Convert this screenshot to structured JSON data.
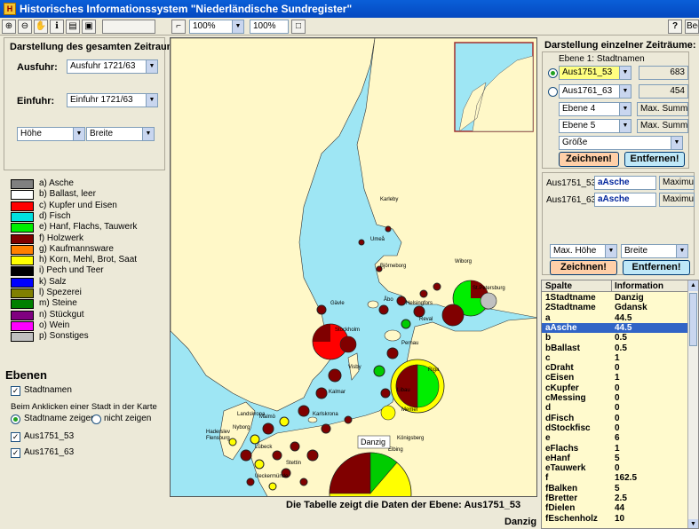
{
  "title": "Historisches Informationssystem \"Niederländische Sundregister\"",
  "toolbar": {
    "zoom1": "100%",
    "zoom2": "100%",
    "help": "?",
    "exit": "Beend"
  },
  "left": {
    "section_title": "Darstellung des gesamten Zeitraums",
    "ausfuhr_label": "Ausfuhr:",
    "ausfuhr_value": "Ausfuhr 1721/63",
    "einfuhr_label": "Einfuhr:",
    "einfuhr_value": "Einfuhr 1721/63",
    "hoehe_value": "Höhe",
    "breite_value": "Breite",
    "legend": [
      {
        "label": "a) Asche",
        "color": "#808080"
      },
      {
        "label": "b) Ballast, leer",
        "color": "#ffffff"
      },
      {
        "label": "c) Kupfer und Eisen",
        "color": "#ff0000"
      },
      {
        "label": "d) Fisch",
        "color": "#00e0e0"
      },
      {
        "label": "e) Hanf, Flachs, Tauwerk",
        "color": "#00ee00"
      },
      {
        "label": "f) Holzwerk",
        "color": "#800000"
      },
      {
        "label": "g) Kaufmannsware",
        "color": "#ff8000"
      },
      {
        "label": "h) Korn, Mehl, Brot, Saat",
        "color": "#ffff00"
      },
      {
        "label": "i) Pech und Teer",
        "color": "#000000"
      },
      {
        "label": "k) Salz",
        "color": "#0000ff"
      },
      {
        "label": "l) Spezerei",
        "color": "#808000"
      },
      {
        "label": "m) Steine",
        "color": "#008000"
      },
      {
        "label": "n) Stückgut",
        "color": "#800080"
      },
      {
        "label": "o) Wein",
        "color": "#ff00ff"
      },
      {
        "label": "p) Sonstiges",
        "color": "#c0c0c0"
      }
    ],
    "ebenen_title": "Ebenen",
    "stadtnamen": "Stadtnamen",
    "click_hint": "Beim Anklicken einer Stadt in der Karte",
    "radio_show": "Stadtname zeigen",
    "radio_hide": "nicht zeigen",
    "layer1": "Aus1751_53",
    "layer2": "Aus1761_63"
  },
  "right": {
    "section_title": "Darstellung einzelner Zeiträume:",
    "group_label": "Ebene 1: Stadtnamen",
    "sel1": "Aus1751_53",
    "val1": "683",
    "sel2": "Aus1761_63",
    "val2": "454",
    "ebene4": "Ebene 4",
    "ebene5": "Ebene 5",
    "max_summe": "Max. Summe",
    "groesse": "Größe",
    "btn_draw": "Zeichnen!",
    "btn_remove": "Entfernen!",
    "row1_label": "Aus1751_53:",
    "row1_field": "aAsche",
    "row1_max": "Maximum",
    "row2_label": "Aus1761_63:",
    "row2_field": "aAsche",
    "row2_max": "Maximum",
    "max_hoehe": "Max. Höhe",
    "breite": "Breite",
    "btn_draw2": "Zeichnen!",
    "btn_remove2": "Entfernen!"
  },
  "grid": {
    "col1": "Spalte",
    "col2": "Information",
    "rows": [
      [
        "1Stadtname",
        "Danzig"
      ],
      [
        "2Stadtname",
        "Gdansk"
      ],
      [
        "a",
        "44.5"
      ],
      [
        "aAsche",
        "44.5"
      ],
      [
        "b",
        "0.5"
      ],
      [
        "bBallast",
        "0.5"
      ],
      [
        "c",
        "1"
      ],
      [
        "cDraht",
        "0"
      ],
      [
        "cEisen",
        "1"
      ],
      [
        "cKupfer",
        "0"
      ],
      [
        "cMessing",
        "0"
      ],
      [
        "d",
        "0"
      ],
      [
        "dFisch",
        "0"
      ],
      [
        "dStockfisc",
        "0"
      ],
      [
        "e",
        "6"
      ],
      [
        "eFlachs",
        "1"
      ],
      [
        "eHanf",
        "5"
      ],
      [
        "eTauwerk",
        "0"
      ],
      [
        "f",
        "162.5"
      ],
      [
        "fBalken",
        "5"
      ],
      [
        "fBretter",
        "2.5"
      ],
      [
        "fDielen",
        "44"
      ],
      [
        "fEschenholz",
        "10"
      ]
    ]
  },
  "map": {
    "cities": [
      "Karleby",
      "Umeå",
      "Björneborg",
      "Wiborg",
      "St.Petersburg",
      "Åbo",
      "Helsingfors",
      "Reval",
      "Gävle",
      "Stockholm",
      "Pernau",
      "Riga",
      "Visby",
      "Libau",
      "Memel",
      "Kalmar",
      "Königsberg",
      "Elbing",
      "Danzig",
      "Karlskrona",
      "Malmö",
      "Landskrona",
      "Flensburg",
      "Lübeck",
      "Stettin",
      "Nyborg",
      "Haderslev",
      "Ueckermünde"
    ],
    "label_danzig": "Danzig"
  },
  "footer": {
    "table_info": "Die Tabelle zeigt die Daten der Ebene: Aus1751_53",
    "city": "Danzig"
  }
}
